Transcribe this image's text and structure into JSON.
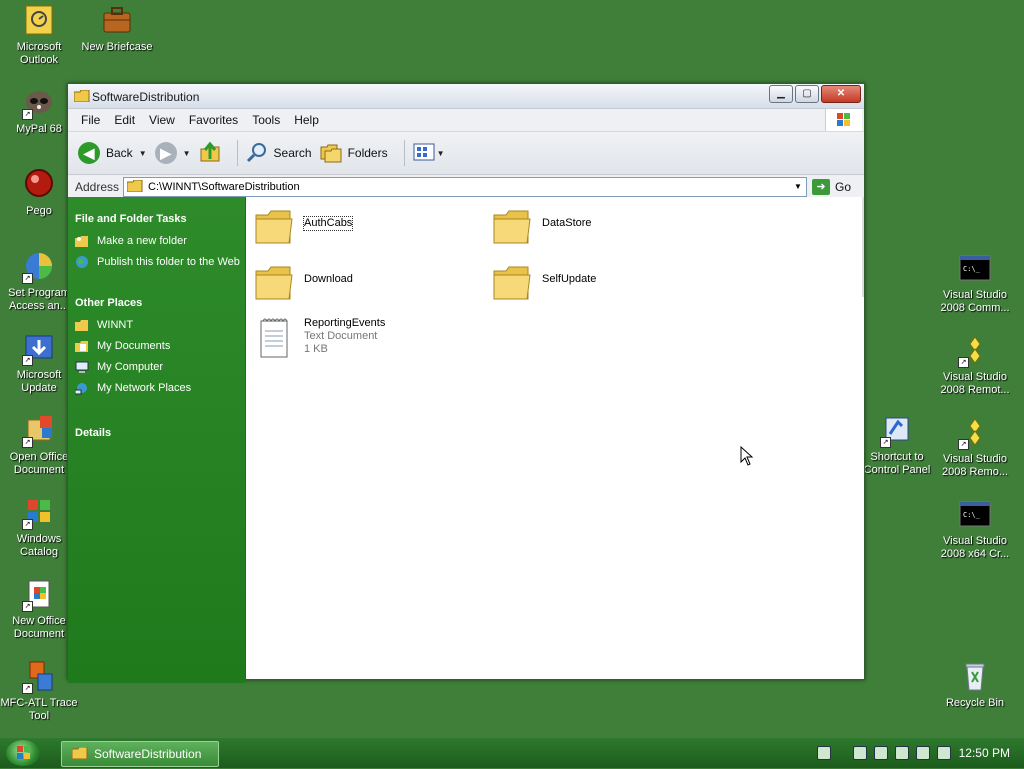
{
  "desktop": {
    "left_icons": [
      {
        "label": "Microsoft Outlook",
        "shortcut": false
      },
      {
        "label": "MyPal 68",
        "shortcut": true
      },
      {
        "label": "Pego",
        "shortcut": false
      },
      {
        "label": "Set Program Access an...",
        "shortcut": true
      },
      {
        "label": "Microsoft Update",
        "shortcut": true
      },
      {
        "label": "Open Office Document",
        "shortcut": true
      },
      {
        "label": "Windows Catalog",
        "shortcut": true
      },
      {
        "label": "New Office Document",
        "shortcut": true
      },
      {
        "label": "MFC-ATL Trace Tool",
        "shortcut": true
      }
    ],
    "top_icon": {
      "label": "New Briefcase"
    },
    "right_icons": [
      {
        "label": "Visual Studio 2008 Comm..."
      },
      {
        "label": "Visual Studio 2008 Remot..."
      },
      {
        "label": "Shortcut to Control Panel"
      },
      {
        "label": "Visual Studio 2008 Remo..."
      },
      {
        "label": "Visual Studio 2008 x64 Cr..."
      },
      {
        "label": "Recycle Bin"
      }
    ]
  },
  "window": {
    "title": "SoftwareDistribution",
    "menu": [
      "File",
      "Edit",
      "View",
      "Favorites",
      "Tools",
      "Help"
    ],
    "toolbar": {
      "back": "Back",
      "search": "Search",
      "folders": "Folders"
    },
    "address": {
      "label": "Address",
      "value": "C:\\WINNT\\SoftwareDistribution",
      "go": "Go"
    },
    "left_pane": {
      "tasks_title": "File and Folder Tasks",
      "tasks": [
        "Make a new folder",
        "Publish this folder to the Web"
      ],
      "places_title": "Other Places",
      "places": [
        "WINNT",
        "My Documents",
        "My Computer",
        "My Network Places"
      ],
      "details_title": "Details"
    },
    "files": [
      {
        "name": "AuthCabs",
        "type": "folder"
      },
      {
        "name": "DataStore",
        "type": "folder"
      },
      {
        "name": "Download",
        "type": "folder"
      },
      {
        "name": "SelfUpdate",
        "type": "folder"
      },
      {
        "name": "ReportingEvents",
        "type": "text",
        "subtype": "Text Document",
        "size": "1 KB"
      }
    ]
  },
  "taskbar": {
    "task_label": "SoftwareDistribution",
    "clock": "12:50 PM"
  }
}
